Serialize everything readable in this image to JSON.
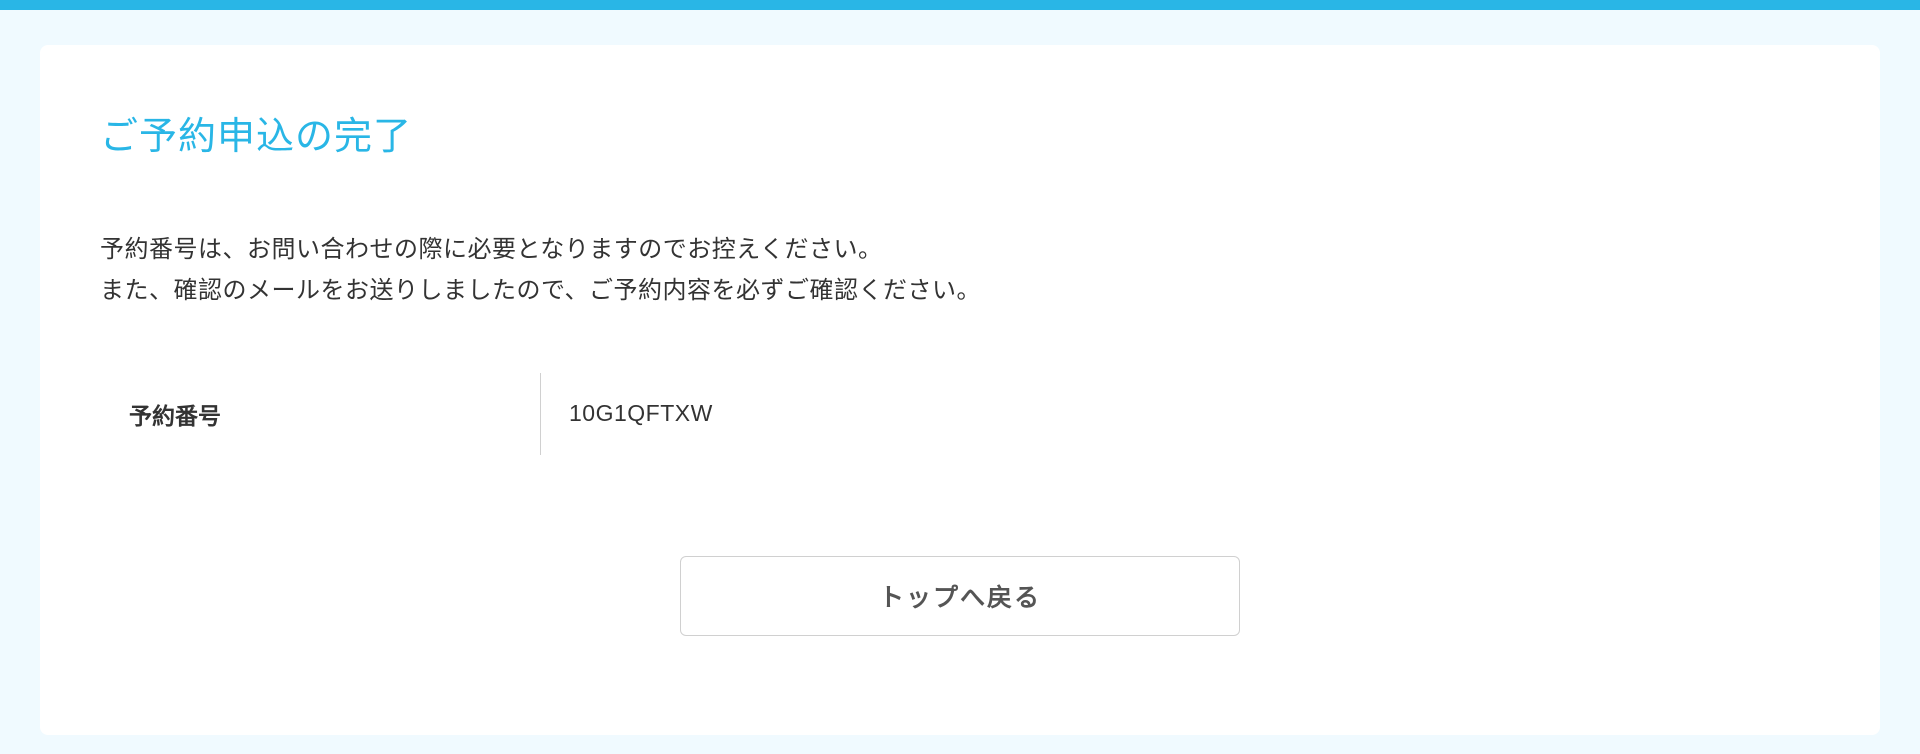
{
  "page": {
    "title": "ご予約申込の完了",
    "description_line1": "予約番号は、お問い合わせの際に必要となりますのでお控えください。",
    "description_line2": "また、確認のメールをお送りしましたので、ご予約内容を必ずご確認ください。"
  },
  "reservation": {
    "label": "予約番号",
    "number": "10G1QFTXW"
  },
  "actions": {
    "back_to_top": "トップへ戻る"
  },
  "colors": {
    "accent": "#29b6e6",
    "page_bg": "#f0faff",
    "card_bg": "#ffffff",
    "border": "#d0d0d0",
    "text": "#333333",
    "button_text": "#555555"
  }
}
